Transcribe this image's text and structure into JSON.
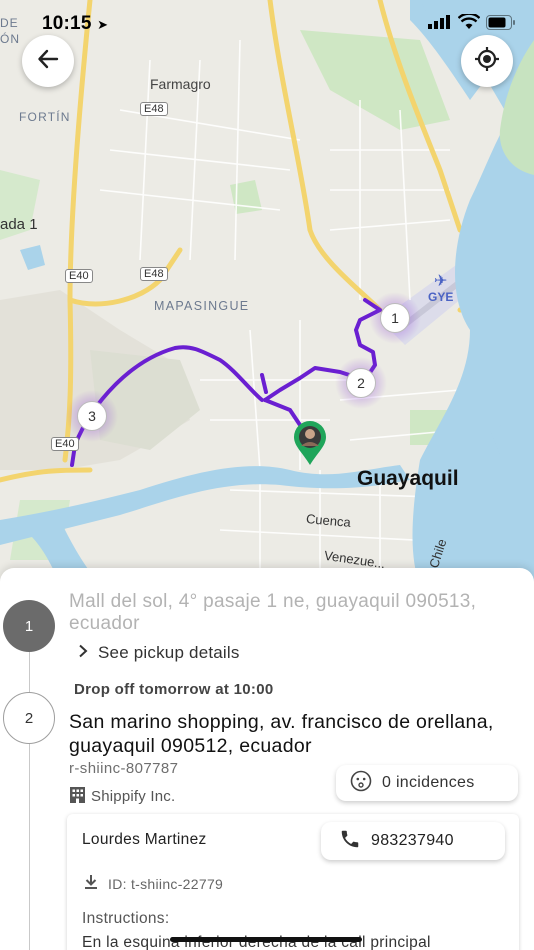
{
  "status_bar": {
    "time": "10:15"
  },
  "map": {
    "labels": {
      "de_don_top": "DE",
      "de_don_bottom": "ÓN",
      "farmagro": "Farmagro",
      "fortin": "FORTÍN",
      "ada1": "ada 1",
      "mapasingue": "MAPASINGUE",
      "gye": "GYE",
      "guayaquil": "Guayaquil",
      "cuenca": "Cuenca",
      "venezuela": "Venezue...",
      "chile": "Chile",
      "e48_top": "E48",
      "e48_mid": "E48",
      "e40_top": "E40",
      "e40_bottom": "E40"
    },
    "markers": [
      {
        "label": "1"
      },
      {
        "label": "2"
      },
      {
        "label": "3"
      }
    ],
    "route_color": "#6a1fd1"
  },
  "sheet": {
    "stop1": {
      "number": "1",
      "address": "Mall del sol, 4° pasaje 1 ne, guayaquil 090513, ecuador",
      "details_link": "See pickup details"
    },
    "stop2": {
      "number": "2",
      "dropoff_time": "Drop off tomorrow at 10:00",
      "address": "San marino shopping, av. francisco de orellana, guayaquil 090512, ecuador",
      "reference": "r-shiinc-807787",
      "company": "Shippify Inc.",
      "incidences": "0 incidences"
    },
    "contact": {
      "name": "Lourdes Martinez",
      "phone": "983237940",
      "id": "ID: t-shiinc-22779",
      "instructions_label": "Instructions:",
      "instructions_text": "En la esquina inferior derecha de la call principal"
    }
  },
  "colors": {
    "route": "#6a1fd1",
    "water": "#a9d5ee",
    "highway": "#f5d26b",
    "pin": "#1fa55a"
  }
}
